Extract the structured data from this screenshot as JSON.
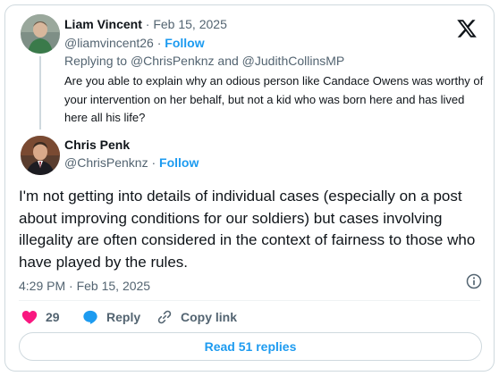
{
  "reply_tweet": {
    "author_name": "Liam Vincent",
    "separator": "·",
    "date": "Feb 15, 2025",
    "handle": "@liamvincent26",
    "follow_label": "Follow",
    "replying_prefix": "Replying to",
    "replying_to_1": "@ChrisPenknz",
    "replying_and": "and",
    "replying_to_2": "@JudithCollinsMP",
    "text": "Are you able to explain why an odious person like Candace Owens was worthy of your intervention on her behalf, but not a kid who was born here and has lived here all his life?"
  },
  "main_tweet": {
    "author_name": "Chris Penk",
    "handle": "@ChrisPenknz",
    "separator": "·",
    "follow_label": "Follow",
    "text": "I'm not getting into details of individual cases (especially on a post about improving conditions for our soldiers) but  cases involving illegality are often considered in the context of fairness to those who have played by the rules.",
    "timestamp": "4:29 PM · Feb 15, 2025"
  },
  "actions": {
    "like_count": "29",
    "reply_label": "Reply",
    "copy_link_label": "Copy link"
  },
  "read_replies_label": "Read 51 replies",
  "colors": {
    "accent": "#1d9bf0",
    "like": "#f91880",
    "text": "#0f1419",
    "secondary": "#536471",
    "border": "#cfd9de"
  },
  "icons": [
    "x-logo-icon",
    "info-icon",
    "heart-icon",
    "reply-bubble-icon",
    "link-icon"
  ]
}
